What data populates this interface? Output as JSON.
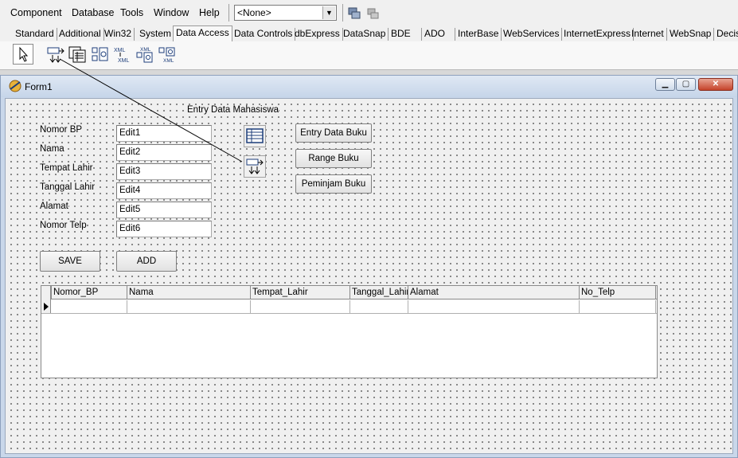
{
  "menu": {
    "items": [
      "Component",
      "Database",
      "Tools",
      "Window",
      "Help"
    ],
    "combo_value": "<None>"
  },
  "palette": {
    "tabs": [
      "Standard",
      "Additional",
      "Win32",
      "System",
      "Data Access",
      "Data Controls",
      "dbExpress",
      "DataSnap",
      "BDE",
      "ADO",
      "InterBase",
      "WebServices",
      "InternetExpress",
      "Internet",
      "WebSnap",
      "Decis"
    ],
    "active_tab": "Data Access",
    "xml_glyph": "XML"
  },
  "form": {
    "title": "Form1",
    "window_buttons": [
      "minimize-icon",
      "maximize-icon",
      "close-icon"
    ],
    "heading": "Entry Data Mahasiswa",
    "fields": [
      {
        "label": "Nomor BP",
        "value": "Edit1"
      },
      {
        "label": "Nama",
        "value": "Edit2"
      },
      {
        "label": "Tempat Lahir",
        "value": "Edit3"
      },
      {
        "label": "Tanggal Lahir",
        "value": "Edit4"
      },
      {
        "label": "Alamat",
        "value": "Edit5"
      },
      {
        "label": "Nomor Telp",
        "value": "Edit6"
      }
    ],
    "side_buttons": [
      "Entry Data Buku",
      "Range Buku",
      "Peminjam Buku"
    ],
    "save_label": "SAVE",
    "add_label": "ADD",
    "grid_columns": [
      "Nomor_BP",
      "Nama",
      "Tempat_Lahir",
      "Tanggal_Lahir",
      "Alamat",
      "No_Telp"
    ]
  },
  "colors": {
    "title_gradient_top": "#dfe8f4",
    "title_gradient_bottom": "#c6d5e9",
    "close_red": "#c5432a",
    "link_line": "#000000"
  }
}
